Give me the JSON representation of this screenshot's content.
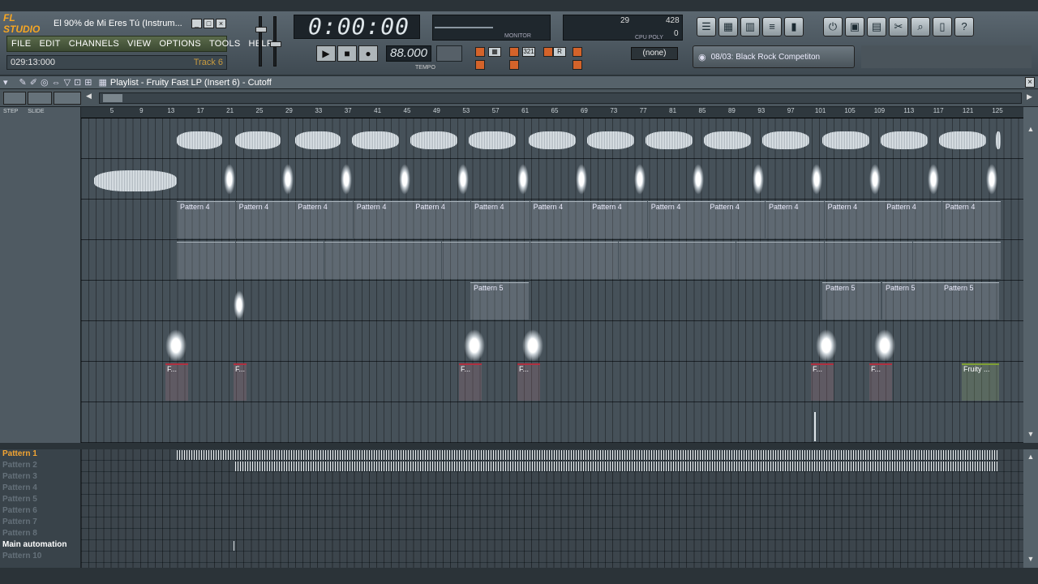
{
  "app": {
    "logo": "FL STUDIO",
    "title": "El 90% de Mi Eres Tú (Instrum..."
  },
  "menu": [
    "FILE",
    "EDIT",
    "CHANNELS",
    "VIEW",
    "OPTIONS",
    "TOOLS",
    "HELP"
  ],
  "hint": {
    "time": "029:13:000",
    "track": "Track 6"
  },
  "transport": {
    "time": "0:00:00",
    "tempo": "88.000",
    "tempo_label": "TEMPO",
    "monitor_label": "MONITOR"
  },
  "cpu": {
    "cpu": "29",
    "poly": "428",
    "poly2": "0",
    "label": "CPU POLY"
  },
  "snap": "(none)",
  "browser": {
    "text": "08/03: Black Rock Competiton"
  },
  "playlist": {
    "title": "Playlist - Fruity Fast LP (Insert 6) - Cutoff",
    "step": "STEP",
    "slide": "SLIDE"
  },
  "ruler": [
    "5",
    "9",
    "13",
    "17",
    "21",
    "25",
    "29",
    "33",
    "37",
    "41",
    "45",
    "49",
    "53",
    "57",
    "61",
    "65",
    "69",
    "73",
    "77",
    "81",
    "85",
    "89",
    "93",
    "97",
    "101",
    "105",
    "109",
    "113",
    "117",
    "121",
    "125"
  ],
  "row3_labels": [
    "Pattern 4",
    "Pattern 4",
    "Pattern 4",
    "Pattern 4",
    "Pattern 4",
    "Pattern 4",
    "Pattern 4",
    "Pattern 4",
    "Pattern 4",
    "Pattern 4",
    "Pattern 4",
    "Pattern 4",
    "Pattern 4",
    "Pattern 4"
  ],
  "row5_labels": [
    "Pattern 5",
    "Pattern 5",
    "Pattern 5",
    "Pattern 5"
  ],
  "auto_labels": [
    "F...",
    "F...",
    "F...",
    "F...",
    "F...",
    "F...",
    "Fruity ..."
  ],
  "picker": [
    "Pattern 1",
    "Pattern 2",
    "Pattern 3",
    "Pattern 4",
    "Pattern 5",
    "Pattern 6",
    "Pattern 7",
    "Pattern 8",
    "Main automation",
    "Pattern 10"
  ],
  "colors": {
    "accent": "#f3a533",
    "automation": "#b03040",
    "green": "#7fa035"
  }
}
